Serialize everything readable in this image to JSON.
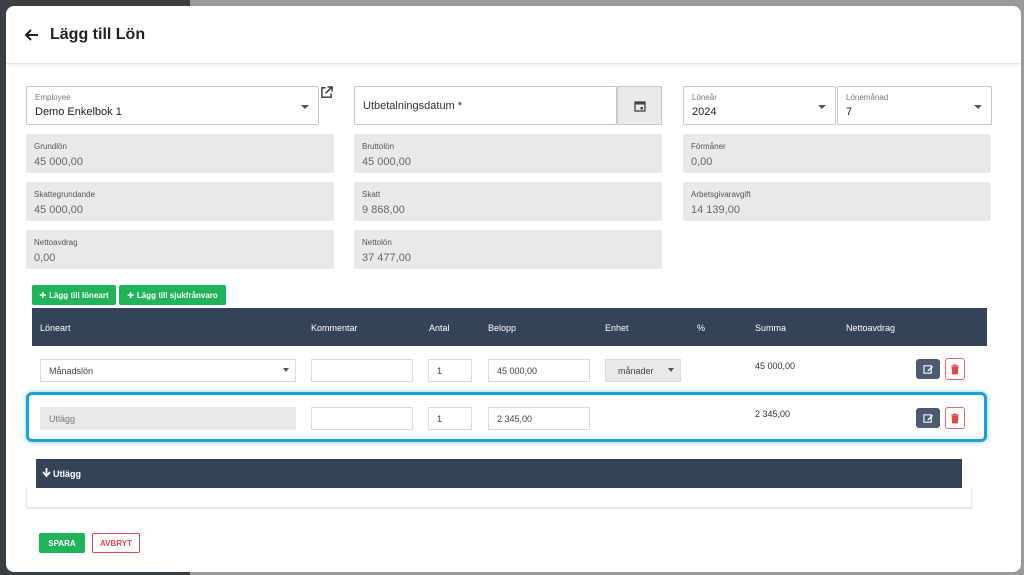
{
  "page": {
    "title": "Lägg till Lön"
  },
  "form": {
    "employee": {
      "label": "Employee",
      "value": "Demo Enkelbok 1"
    },
    "payment_date": {
      "placeholder": "Utbetalningsdatum *"
    },
    "salary_year": {
      "label": "Löneår",
      "value": "2024"
    },
    "salary_month": {
      "label": "Lönemånad",
      "value": "7"
    }
  },
  "summary": {
    "grundlon": {
      "label": "Grundlön",
      "value": "45 000,00"
    },
    "bruttolon": {
      "label": "Bruttolön",
      "value": "45 000,00"
    },
    "formaner": {
      "label": "Förmåner",
      "value": "0,00"
    },
    "skattegrundande": {
      "label": "Skattegrundande",
      "value": "45 000,00"
    },
    "skatt": {
      "label": "Skatt",
      "value": "9 868,00"
    },
    "arbetsgivaravgift": {
      "label": "Arbetsgivaravgift",
      "value": "14 139,00"
    },
    "nettoavdrag": {
      "label": "Nettoavdrag",
      "value": "0,00"
    },
    "nettolon": {
      "label": "Nettolön",
      "value": "37 477,00"
    }
  },
  "actions": {
    "add_salary_type": "Lägg till löneart",
    "add_sick_leave": "Lägg till sjukfrånvaro",
    "save": "SPARA",
    "cancel": "AVBRYT"
  },
  "table": {
    "headers": {
      "loneart": "Löneart",
      "kommentar": "Kommentar",
      "antal": "Antal",
      "belopp": "Belopp",
      "enhet": "Enhet",
      "procent": "%",
      "summa": "Summa",
      "nettoavdrag": "Nettoavdrag"
    },
    "rows": [
      {
        "loneart": "Månadslön",
        "kommentar": "",
        "antal": "1",
        "belopp": "45 000,00",
        "enhet": "månader",
        "summa": "45 000,00"
      },
      {
        "loneart": "Utlägg",
        "kommentar": "",
        "antal": "1",
        "belopp": "2 345,00",
        "enhet": "",
        "summa": "2 345,00"
      }
    ]
  },
  "utlagg_section": {
    "label": "Utlägg"
  },
  "colors": {
    "green": "#1fb35a",
    "navy": "#354359",
    "highlight": "#1da0d6",
    "danger": "#d94a4a"
  }
}
